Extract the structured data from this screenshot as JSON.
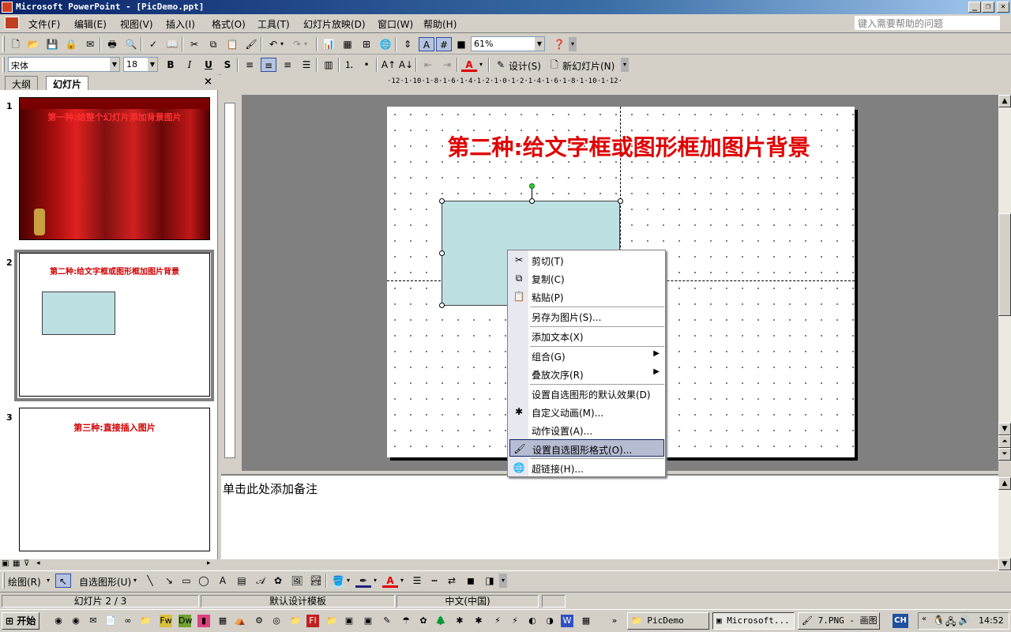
{
  "window": {
    "title": "Microsoft PowerPoint - [PicDemo.ppt]",
    "min": "_",
    "restore": "❐",
    "close": "✕"
  },
  "menu": [
    "文件(F)",
    "编辑(E)",
    "视图(V)",
    "插入(I)",
    "格式(O)",
    "工具(T)",
    "幻灯片放映(D)",
    "窗口(W)",
    "帮助(H)"
  ],
  "help_box": "键入需要帮助的问题",
  "standard_toolbar": {
    "zoom": "61%"
  },
  "formatting_toolbar": {
    "font": "宋体",
    "size": "18",
    "bold": "B",
    "italic": "I",
    "underline": "U",
    "shadow": "S",
    "design": "设计(S)",
    "new_slide": "新幻灯片(N)"
  },
  "left_pane": {
    "tabs": [
      "大纲",
      "幻灯片"
    ],
    "close": "×",
    "slides": [
      {
        "num": "1",
        "title": "第一种:给整个幻灯片添加背景图片"
      },
      {
        "num": "2",
        "title": "第二种:给文字框或图形框加图片背景"
      },
      {
        "num": "3",
        "title": "第三种:直接插入图片"
      }
    ]
  },
  "ruler_text": "·12·1·10·1·8·1·6·1·4·1·2·1·0·1·2·1·4·1·6·1·8·1·10·1·12·",
  "slide": {
    "title": "第二种:给文字框或图形框加图片背景"
  },
  "notes": "单击此处添加备注",
  "context_menu": [
    {
      "label": "剪切(T)",
      "icon": "✂"
    },
    {
      "label": "复制(C)",
      "icon": "⧉"
    },
    {
      "label": "粘贴(P)",
      "icon": "📋"
    },
    {
      "label": "另存为图片(S)...",
      "icon": ""
    },
    {
      "label": "添加文本(X)",
      "icon": ""
    },
    {
      "label": "组合(G)",
      "icon": "",
      "submenu": true
    },
    {
      "label": "叠放次序(R)",
      "icon": "",
      "submenu": true
    },
    {
      "label": "设置自选图形的默认效果(D)",
      "icon": ""
    },
    {
      "label": "自定义动画(M)...",
      "icon": "✱"
    },
    {
      "label": "动作设置(A)...",
      "icon": ""
    },
    {
      "label": "设置自选图形格式(O)...",
      "icon": "🖌"
    },
    {
      "label": "超链接(H)...",
      "icon": "🌐"
    }
  ],
  "draw_toolbar": {
    "draw": "绘图(R)",
    "autoshapes": "自选图形(U)"
  },
  "status_bar": {
    "slide": "幻灯片 2 / 3",
    "template": "默认设计模板",
    "language": "中文(中国)"
  },
  "taskbar": {
    "start": "开始",
    "tasks": [
      "PicDemo",
      "Microsoft...",
      "7.PNG - 画图"
    ],
    "lang": "CH",
    "time": "14:52"
  }
}
